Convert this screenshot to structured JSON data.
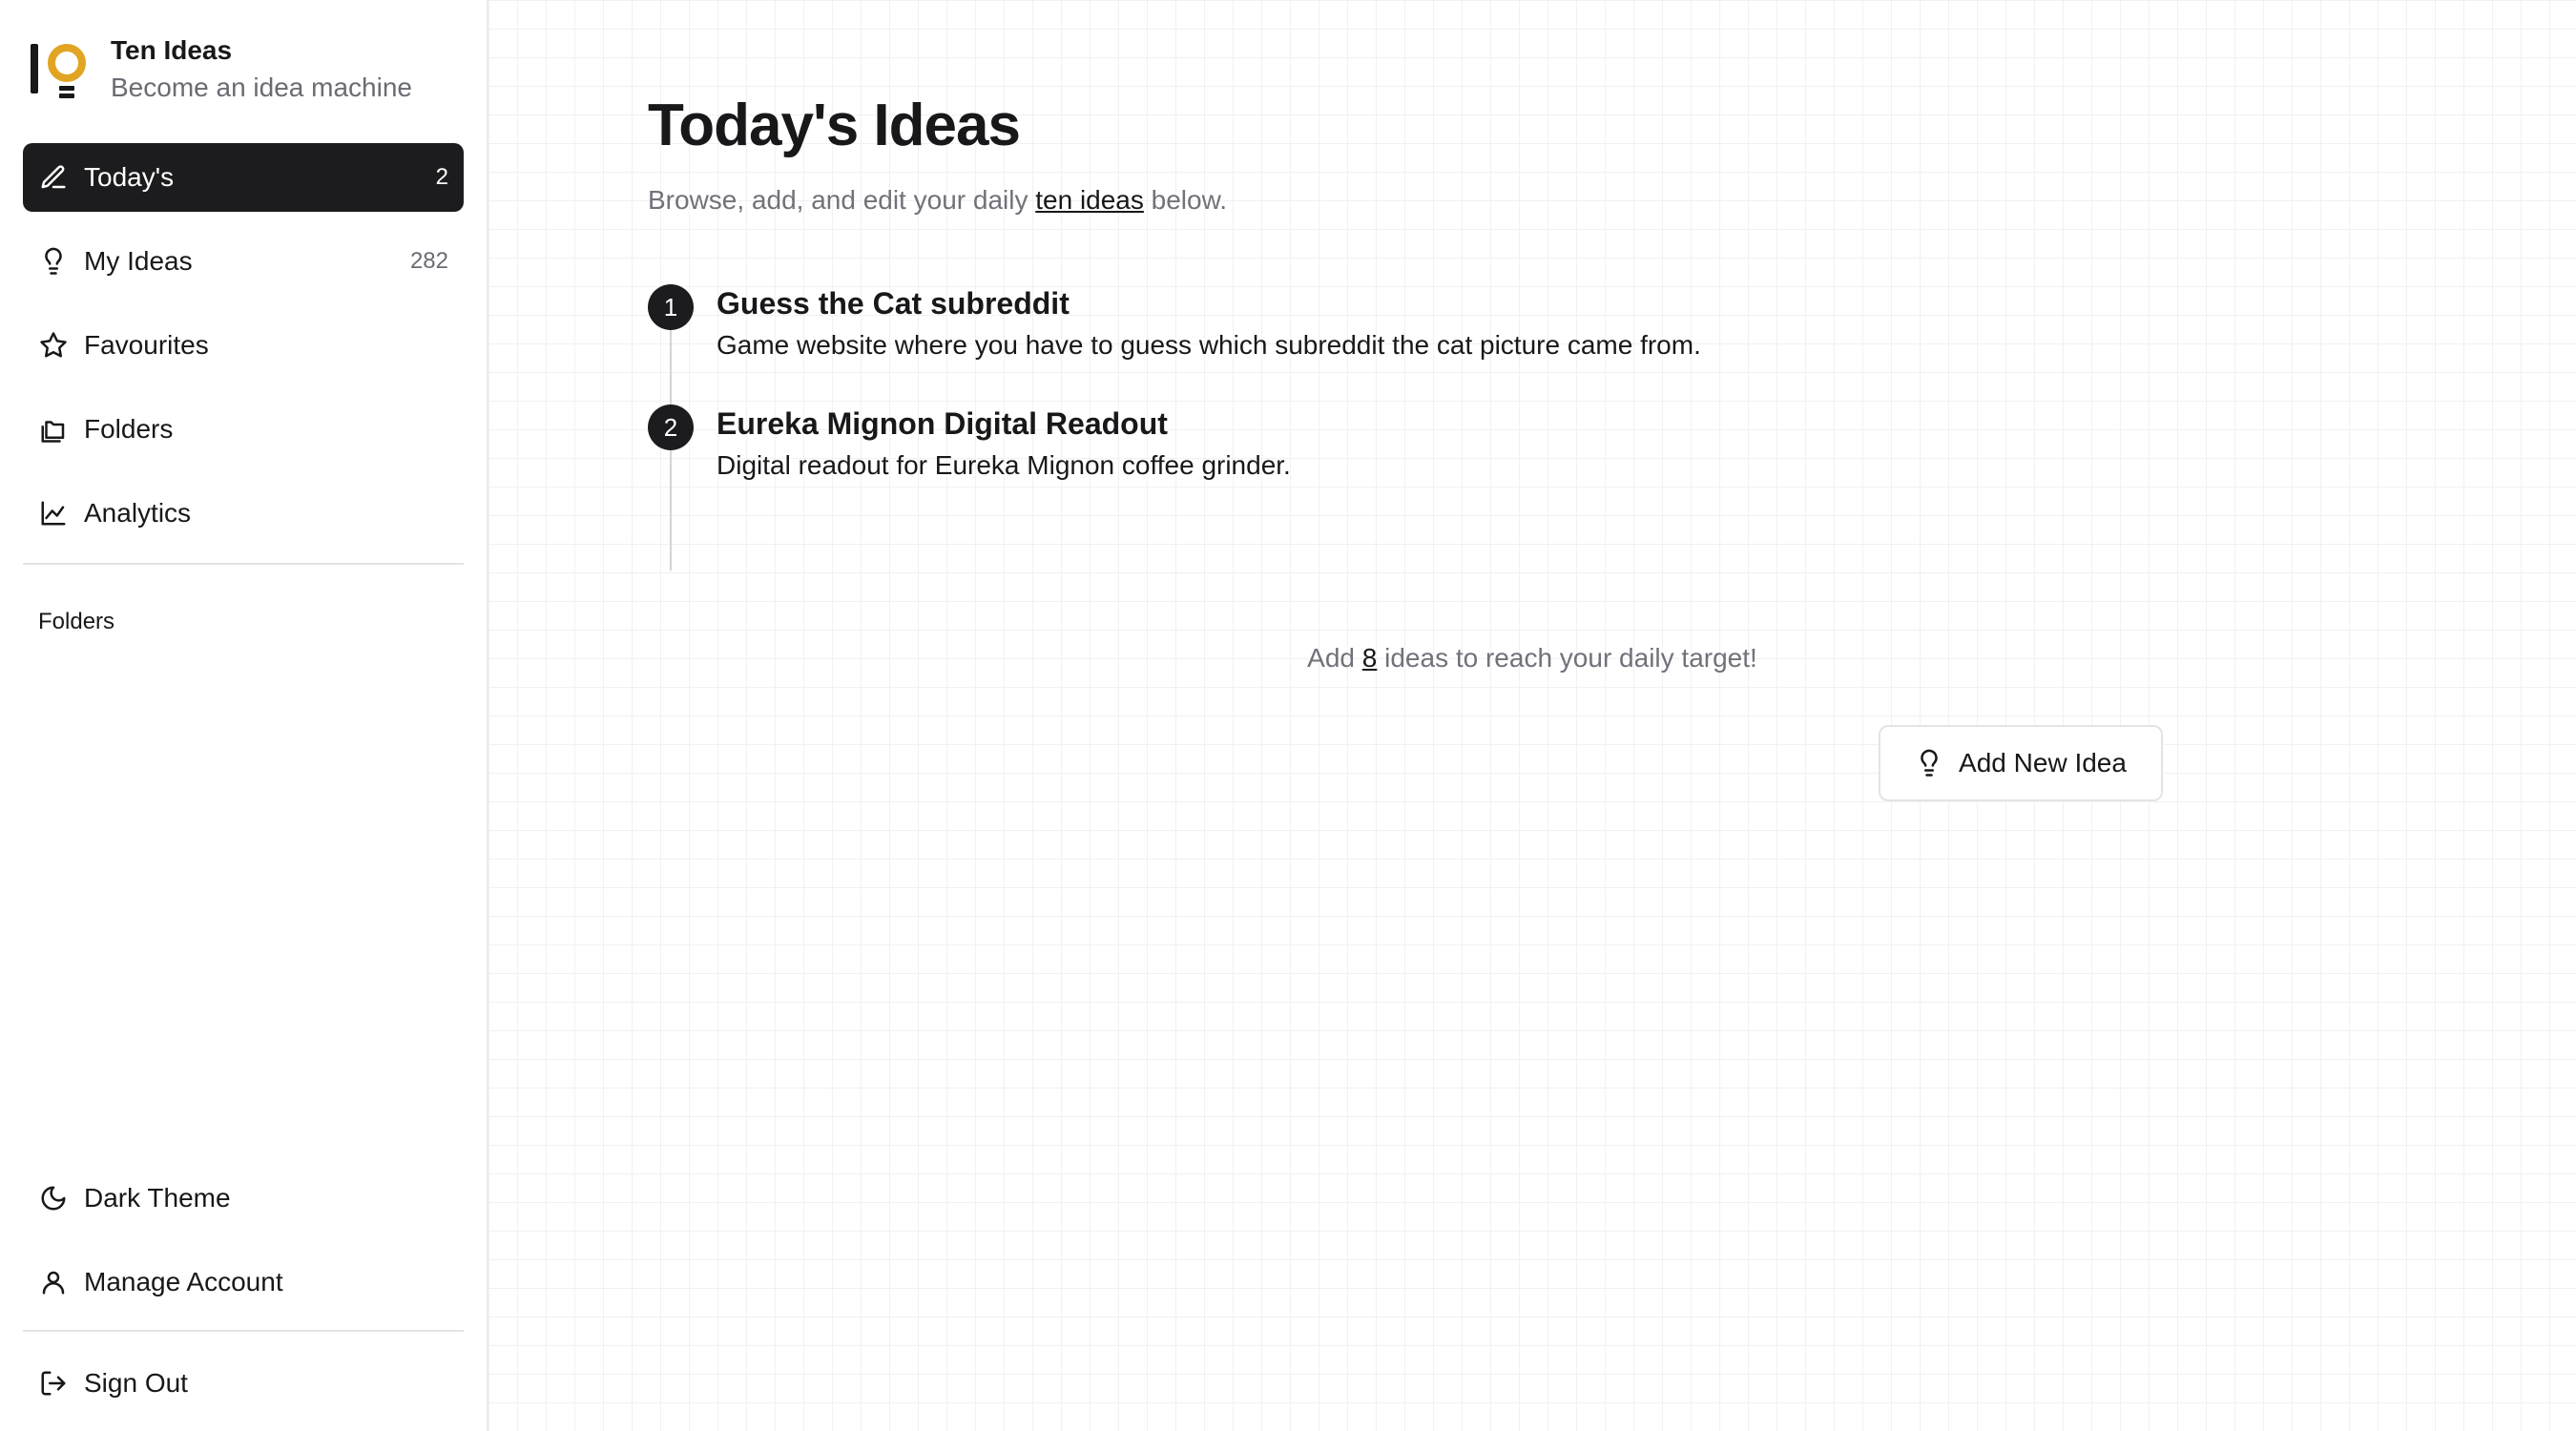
{
  "brand": {
    "title": "Ten Ideas",
    "subtitle": "Become an idea machine",
    "logo_colors": {
      "bulb": "#e1a423",
      "bar": "#18181b"
    }
  },
  "nav": [
    {
      "label": "Today's",
      "count": "2",
      "icon": "pencil-icon",
      "active": true
    },
    {
      "label": "My Ideas",
      "count": "282",
      "icon": "lightbulb-icon",
      "active": false
    },
    {
      "label": "Favourites",
      "count": "",
      "icon": "star-icon",
      "active": false
    },
    {
      "label": "Folders",
      "count": "",
      "icon": "folders-icon",
      "active": false
    },
    {
      "label": "Analytics",
      "count": "",
      "icon": "chart-icon",
      "active": false
    }
  ],
  "folders_section": {
    "title": "Folders"
  },
  "bottom_nav": {
    "dark_theme": "Dark Theme",
    "manage_account": "Manage Account",
    "sign_out": "Sign Out"
  },
  "main": {
    "title": "Today's Ideas",
    "desc_before": "Browse, add, and edit your daily ",
    "desc_link": "ten ideas",
    "desc_after": " below.",
    "ideas": [
      {
        "number": "1",
        "title": "Guess the Cat subreddit",
        "description": "Game website where you have to guess which subreddit the cat picture came from."
      },
      {
        "number": "2",
        "title": "Eureka Mignon Digital Readout",
        "description": "Digital readout for Eureka Mignon coffee grinder."
      }
    ],
    "target_before": "Add ",
    "target_count": "8",
    "target_after": " ideas to reach your daily target!",
    "add_button": "Add New Idea"
  },
  "colors": {
    "active_bg": "#1c1c1e",
    "muted_text": "#71717a",
    "accent": "#e1a423"
  }
}
